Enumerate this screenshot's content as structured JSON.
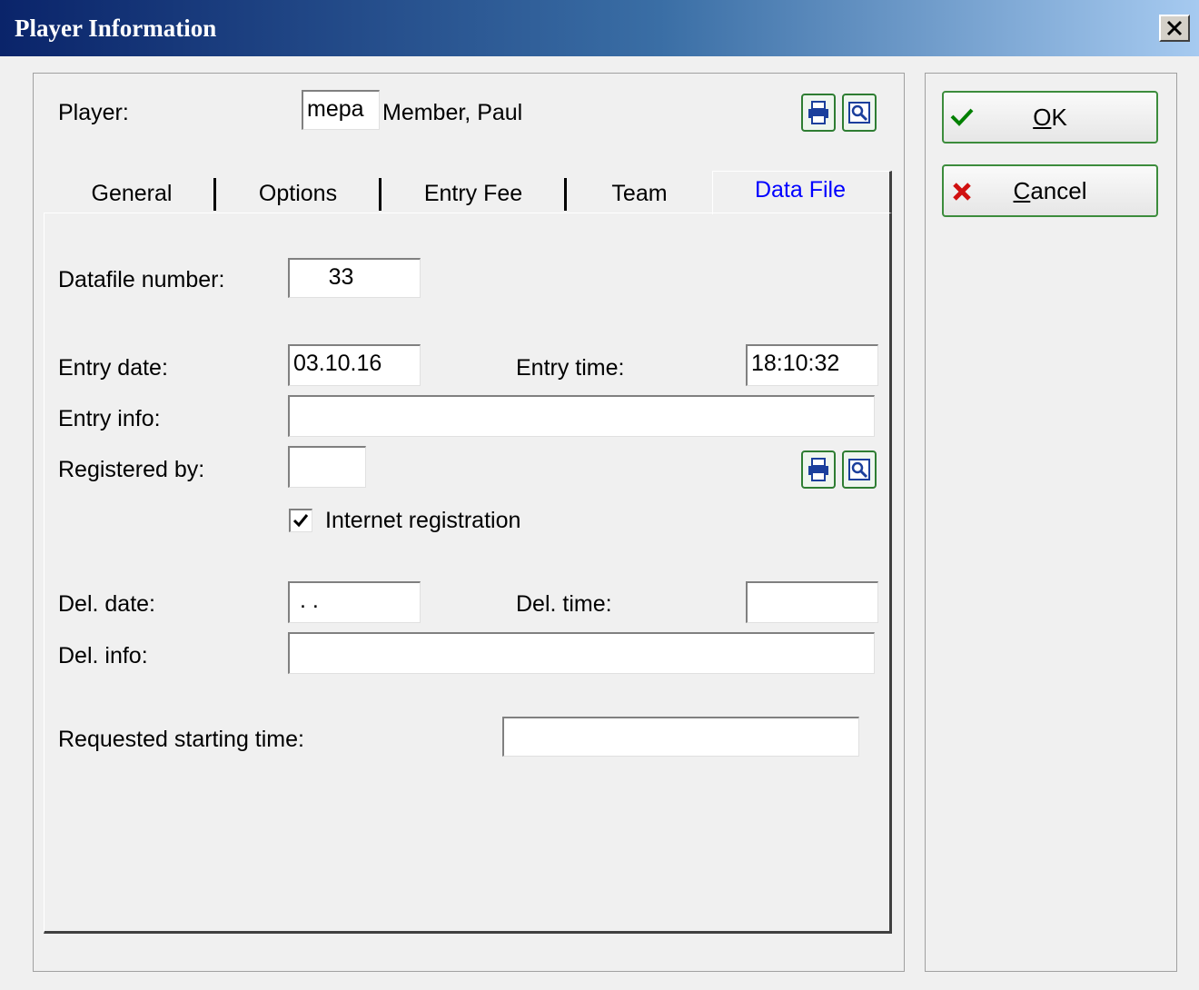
{
  "window": {
    "title": "Player Information",
    "close_label": "×"
  },
  "player": {
    "label": "Player:",
    "code": "mepa",
    "name": "Member, Paul"
  },
  "tabs": [
    {
      "label": "General",
      "active": false
    },
    {
      "label": "Options",
      "active": false
    },
    {
      "label": "Entry Fee",
      "active": false
    },
    {
      "label": "Team",
      "active": false
    },
    {
      "label": "Data File",
      "active": true
    }
  ],
  "datafile": {
    "number_label": "Datafile number:",
    "number": "33",
    "entry_date_label": "Entry date:",
    "entry_date": "03.10.16",
    "entry_time_label": "Entry time:",
    "entry_time": "18:10:32",
    "entry_info_label": "Entry info:",
    "entry_info": "",
    "registered_by_label": "Registered by:",
    "registered_by": "",
    "internet_label": "Internet registration",
    "internet_checked": true,
    "del_date_label": "Del. date:",
    "del_date": " . .",
    "del_time_label": "Del. time:",
    "del_time": "",
    "del_info_label": "Del. info:",
    "del_info": "",
    "req_start_label": "Requested starting time:",
    "req_start": ""
  },
  "buttons": {
    "ok": "OK",
    "cancel": "Cancel"
  },
  "colors": {
    "active_tab": "#0000ff",
    "title_gradient_start": "#0a246a",
    "ok_check": "#008000",
    "cancel_x": "#d01010"
  },
  "icons": [
    "print-icon",
    "search-icon",
    "check-icon",
    "cancel-x-icon",
    "close-icon"
  ]
}
